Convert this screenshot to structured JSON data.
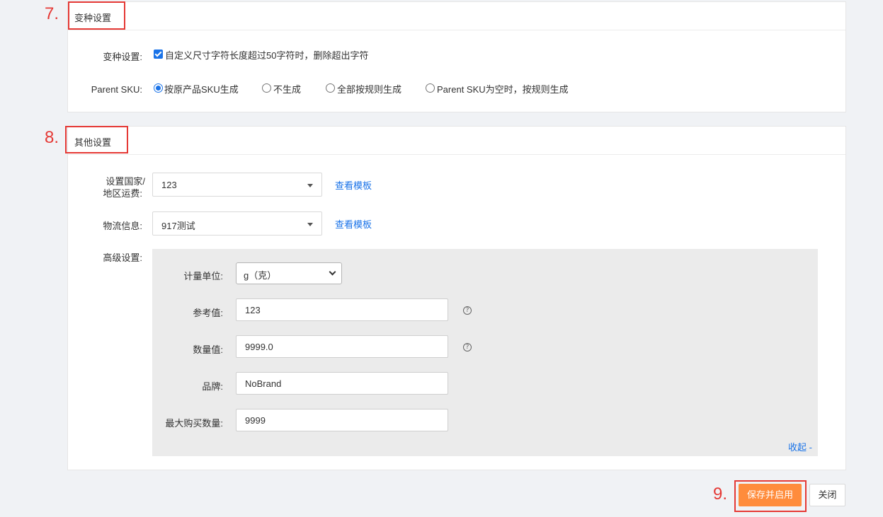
{
  "annotations": {
    "step7": "7.",
    "step8": "8.",
    "step9": "9."
  },
  "variant_section": {
    "title": "变种设置",
    "variant_label": "变种设置:",
    "variant_checkbox_text": "自定义尺寸字符长度超过50字符时，删除超出字符",
    "variant_checked": true,
    "parent_sku_label": "Parent SKU:",
    "parent_sku_options": [
      {
        "label": "按原产品SKU生成",
        "selected": true
      },
      {
        "label": "不生成",
        "selected": false
      },
      {
        "label": "全部按规则生成",
        "selected": false
      },
      {
        "label": "Parent SKU为空时，按规则生成",
        "selected": false
      }
    ]
  },
  "other_section": {
    "title": "其他设置",
    "shipping_label_line1": "设置国家/",
    "shipping_label_line2": "地区运费:",
    "shipping_value": "123",
    "shipping_link": "查看模板",
    "logistics_label": "物流信息:",
    "logistics_value": "917测试",
    "logistics_link": "查看模板",
    "advanced_label": "高级设置:",
    "advanced": {
      "unit_label": "计量单位:",
      "unit_value": "g（克）",
      "reference_label": "参考值:",
      "reference_value": "123",
      "quantity_label": "数量值:",
      "quantity_value": "9999.0",
      "brand_label": "品牌:",
      "brand_value": "NoBrand",
      "max_purchase_label": "最大购买数量:",
      "max_purchase_value": "9999",
      "collapse_link": "收起 -",
      "help_glyph": "?"
    }
  },
  "footer": {
    "save_enable_label": "保存并启用",
    "close_label": "关闭"
  },
  "colors": {
    "accent": "#1a73e8",
    "primary_button": "#ff8c3c",
    "annotation": "#e53935"
  }
}
